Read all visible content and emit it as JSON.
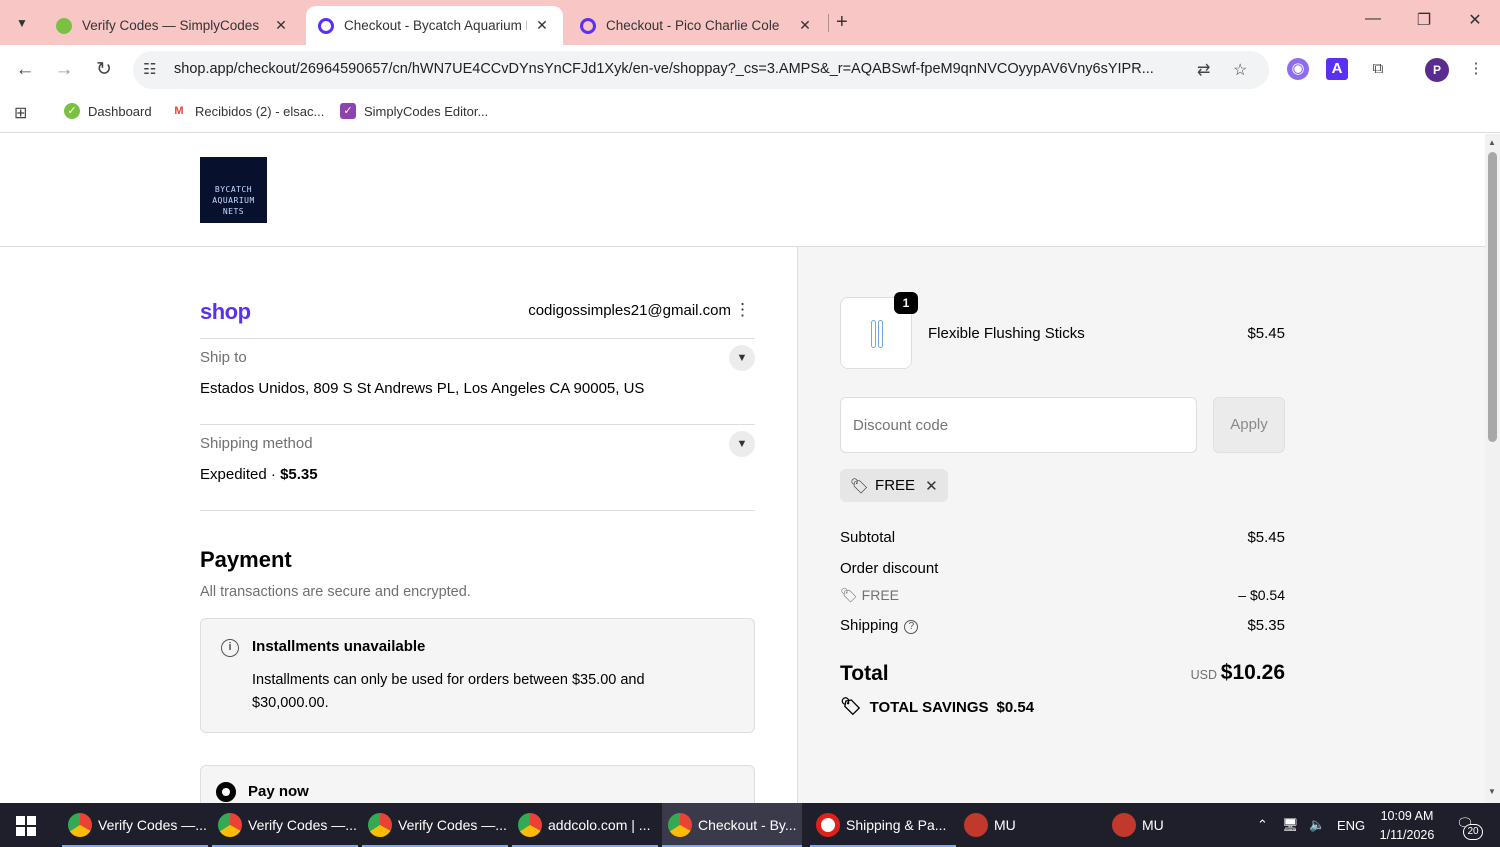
{
  "browser": {
    "tabs": [
      {
        "title": "Verify Codes — SimplyCodes",
        "close": "✕",
        "favicon_color": "#7ac143"
      },
      {
        "title": "Checkout - Bycatch Aquarium N",
        "close": "✕",
        "favicon_color": "#5a31f4"
      },
      {
        "title": "Checkout - Pico Charlie Cole",
        "close": "✕",
        "favicon_color": "#5a31f4"
      }
    ],
    "new_tab": "+",
    "url": "shop.app/checkout/26964590657/cn/hWN7UE4CCvDYnsYnCFJd1Xyk/en-ve/shoppay?_cs=3.AMPS&_r=AQABSwf-fpeM9qnNVCOyypAV6Vny6sYIPR...",
    "profile_initial": "P",
    "bookmarks": [
      {
        "label": "Dashboard",
        "icon_color": "#7ac143"
      },
      {
        "label": "Recibidos (2) - elsac...",
        "icon_color": "#ea4335"
      },
      {
        "label": "SimplyCodes Editor...",
        "icon_color": "#8e44ad"
      }
    ]
  },
  "store": {
    "logo_text": [
      "BYCATCH",
      "AQUARIUM",
      "NETS"
    ]
  },
  "checkout": {
    "shop_logo": "shop",
    "email": "codigossimples21@gmail.com",
    "ship_to_label": "Ship to",
    "ship_to_value": "Estados Unidos, 809 S St Andrews PL, Los Angeles CA 90005, US",
    "shipping_method_label": "Shipping method",
    "shipping_method_name": "Expedited",
    "shipping_method_sep": " · ",
    "shipping_method_price": "$5.35",
    "payment_title": "Payment",
    "payment_subtitle": "All transactions are secure and encrypted.",
    "installments_title": "Installments unavailable",
    "installments_text": "Installments can only be used for orders between $35.00 and $30,000.00.",
    "pay_now_label": "Pay now"
  },
  "order_summary": {
    "product_name": "Flexible Flushing Sticks",
    "product_price": "$5.45",
    "quantity": "1",
    "discount_placeholder": "Discount code",
    "apply_label": "Apply",
    "applied_code": "FREE",
    "subtotal_label": "Subtotal",
    "subtotal_value": "$5.45",
    "order_discount_label": "Order discount",
    "discount_code": "FREE",
    "discount_value": "– $0.54",
    "shipping_label": "Shipping",
    "shipping_value": "$5.35",
    "total_label": "Total",
    "total_currency": "USD",
    "total_value": "$10.26",
    "savings_label": "TOTAL SAVINGS",
    "savings_value": "$0.54"
  },
  "taskbar": {
    "items": [
      {
        "label": "Verify Codes —...",
        "icon_color": "#4285f4"
      },
      {
        "label": "Verify Codes —...",
        "icon_color": "#34a853"
      },
      {
        "label": "Verify Codes —...",
        "icon_color": "#4285f4"
      },
      {
        "label": "addcolo.com | ...",
        "icon_color": "#fbbc05"
      },
      {
        "label": "Checkout - By...",
        "icon_color": "#4285f4"
      },
      {
        "label": "Shipping & Pa...",
        "icon_color": "#e0201b"
      },
      {
        "label": "MU",
        "icon_color": "#c0392b"
      },
      {
        "label": "MU",
        "icon_color": "#c0392b"
      }
    ],
    "language": "ENG",
    "time": "10:09 AM",
    "date": "1/11/2026",
    "notifications": "20"
  }
}
